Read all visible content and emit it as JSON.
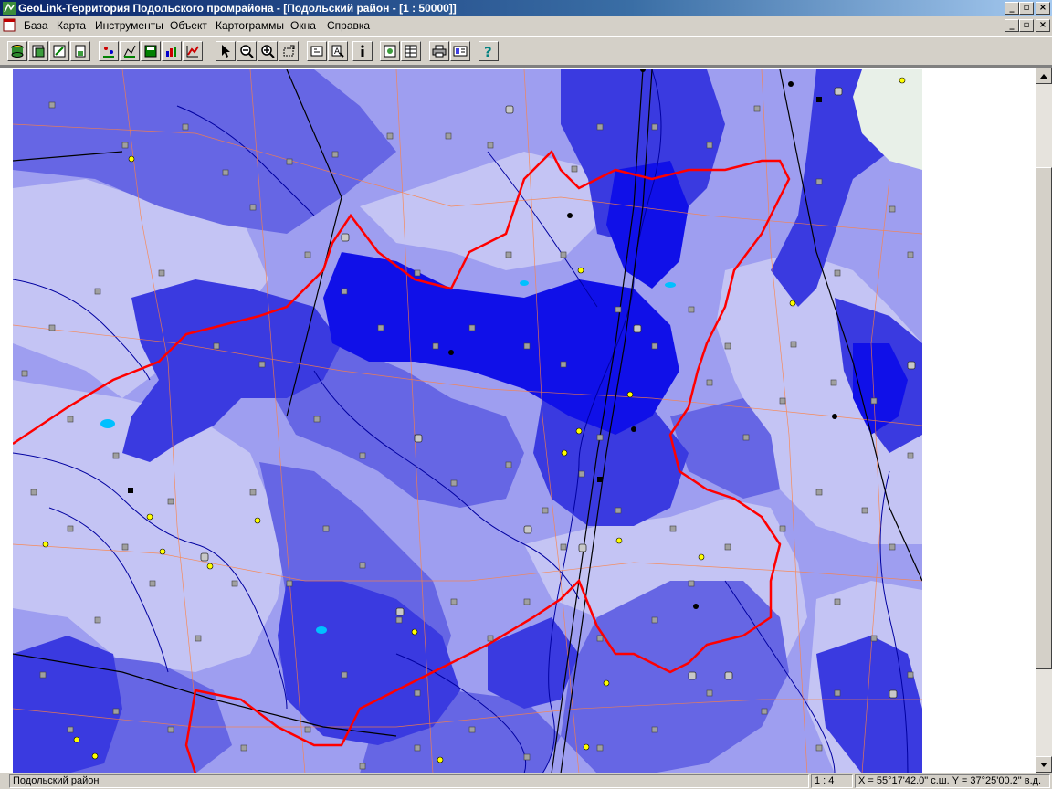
{
  "window": {
    "title": "GeoLink-Территория Подольского промрайона - [Подольский район - [1 : 50000]]"
  },
  "menu": {
    "items": [
      "База",
      "Карта",
      "Инструменты",
      "Объект",
      "Картограммы",
      "Окна",
      "Справка"
    ]
  },
  "toolbar": {
    "buttons": [
      "open-db-icon",
      "db-list-icon",
      "db-edit-icon",
      "db-new-icon",
      "layer-points-icon",
      "layer-edit-icon",
      "save-layer-icon",
      "cartogram-icon",
      "chart-icon",
      "pointer-icon",
      "zoom-out-icon",
      "zoom-in-icon",
      "zoom-window-icon",
      "object-info-icon",
      "identify-icon",
      "info-icon",
      "new-window-icon",
      "table-icon",
      "print-icon",
      "legend-icon",
      "help-icon"
    ]
  },
  "map": {
    "colors": {
      "darkest": "#1010e8",
      "dark": "#3a3ae0",
      "medium": "#6666e4",
      "light": "#9e9ef0",
      "lightest": "#c4c4f4",
      "boundary": "#ff0000",
      "roads": "#ff8040",
      "rivers": "#0000a0",
      "railway": "#000000"
    }
  },
  "status": {
    "region": "Подольский район",
    "ratio": "1 : 4",
    "coords": "X = 55°17'42.0\" с.ш.  Y = 37°25'00.2\" в.д."
  }
}
